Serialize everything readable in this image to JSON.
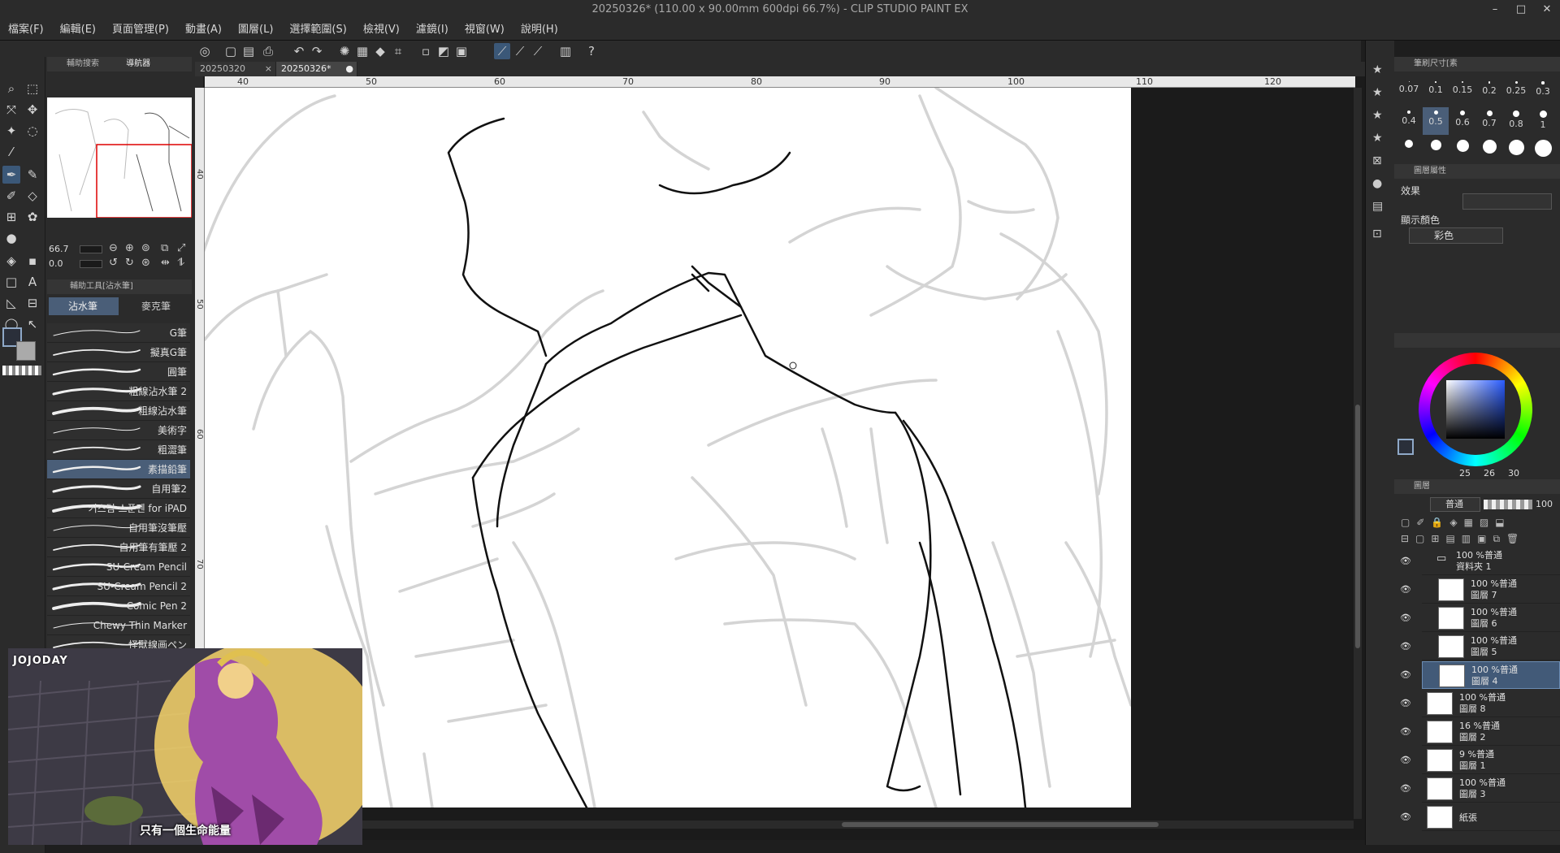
{
  "window": {
    "title": "20250326* (110.00 x 90.00mm 600dpi 66.7%)  - CLIP STUDIO PAINT EX",
    "minimize": "–",
    "maximize": "□",
    "close": "✕"
  },
  "menu": [
    "檔案(F)",
    "編輯(E)",
    "頁面管理(P)",
    "動畫(A)",
    "圖層(L)",
    "選擇範圍(S)",
    "檢視(V)",
    "濾鏡(I)",
    "視窗(W)",
    "說明(H)"
  ],
  "doc_tabs": [
    {
      "label": "20250320",
      "close": "×"
    },
    {
      "label": "20250326*",
      "close": "●"
    }
  ],
  "left_panel": {
    "tabs": [
      "輔助搜索",
      "導航器"
    ],
    "zoom_value": "66.7",
    "rotate_value": "0.0",
    "subtool_header": "輔助工具[沾水筆]",
    "subtool_tabs": [
      "沾水筆",
      "麥克筆"
    ],
    "brushes": [
      "G筆",
      "擬真G筆",
      "圓筆",
      "粗線沾水筆 2",
      "粗線沾水筆",
      "美術字",
      "粗澀筆",
      "素描鉛筆",
      "自用筆2",
      "커스텀 스푼펜 for iPAD",
      "自用筆沒筆壓",
      "自用筆有筆壓 2",
      "SU-Cream Pencil",
      "SU-Cream Pencil 2",
      "Comic Pen 2",
      "Chewy Thin Marker",
      "怪獸線画ペン"
    ],
    "selected_brush_index": 7
  },
  "ruler": {
    "top_labels": [
      "40",
      "50",
      "60",
      "70",
      "80",
      "90",
      "100",
      "110",
      "120"
    ],
    "left_labels": [
      "40",
      "50",
      "60",
      "70"
    ]
  },
  "right_panel": {
    "brush_size_header": "筆刷尺寸[素",
    "brush_sizes_row1": [
      "0.07",
      "0.1",
      "0.15",
      "0.2",
      "0.25",
      "0.3"
    ],
    "brush_sizes_row2": [
      "0.4",
      "0.5",
      "0.6",
      "0.7",
      "0.8",
      "1"
    ],
    "selected_size": "0.5",
    "layer_property_header": "圖層屬性",
    "effect_label": "效果",
    "display_color_label": "顯示顏色",
    "display_color_value": "彩色",
    "color_values": {
      "r": "25",
      "g": "26",
      "b": "30"
    },
    "layers_tabs": [
      "圖層",
      "",
      ""
    ],
    "blend_mode": "普通",
    "opacity": "100",
    "layers": [
      {
        "top": "100 %普通",
        "name": "資料夾 1",
        "folder": true,
        "indent": 0
      },
      {
        "top": "100 %普通",
        "name": "圖層 7",
        "indent": 1
      },
      {
        "top": "100 %普通",
        "name": "圖層 6",
        "indent": 1
      },
      {
        "top": "100 %普通",
        "name": "圖層 5",
        "indent": 1
      },
      {
        "top": "100 %普通",
        "name": "圖層 4",
        "indent": 1,
        "selected": true
      },
      {
        "top": "100 %普通",
        "name": "圖層 8",
        "indent": 0
      },
      {
        "top": "16 %普通",
        "name": "圖層 2",
        "indent": 0
      },
      {
        "top": "9 %普通",
        "name": "圖層 1",
        "indent": 0
      },
      {
        "top": "100 %普通",
        "name": "圖層 3",
        "indent": 0
      },
      {
        "top": "",
        "name": "紙張",
        "indent": 0
      }
    ]
  },
  "video_overlay": {
    "logo": "JOJODAY",
    "subtitle": "只有一個生命能量"
  },
  "colors": {
    "accent": "#3b5878",
    "panel": "#2b2b2b"
  }
}
